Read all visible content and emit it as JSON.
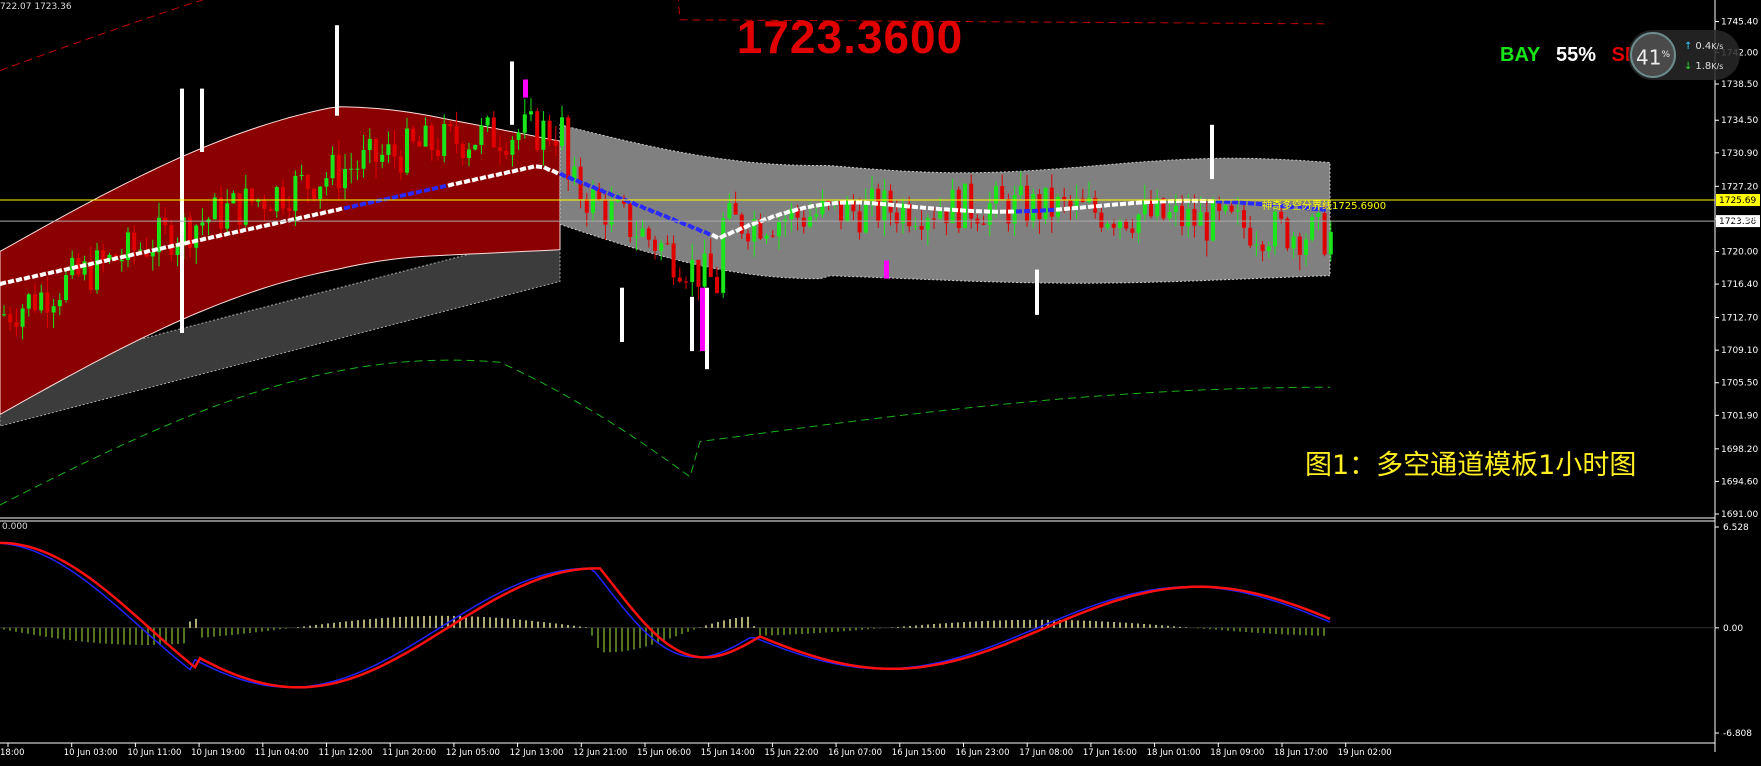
{
  "header": {
    "corner_price": "722.07 1723.36",
    "big_price": "1723.3600"
  },
  "signal": {
    "bay": "BAY",
    "percent": "55%",
    "sell": "SE"
  },
  "widget": {
    "cpu": "41",
    "unit": "%",
    "upload": "0.4",
    "upload_unit": "K/s",
    "download": "1.8",
    "download_unit": "K/s"
  },
  "caption": "图1：多空通道模板1小时图",
  "horizontal_line_label": "神奇多空分界线1725.6900",
  "subwindow_label": "0.000",
  "colors": {
    "bull_candle": "#19e619",
    "bear_candle": "#e00000",
    "upper_channel_fill": "#8b0000",
    "gray_channel_fill": "#808080",
    "dark_channel_fill": "#3c3c3c",
    "outer_top_dashed": "#c00000",
    "outer_bottom_dashed": "#19b019",
    "price_line": "#ffff00",
    "macd_main": "#2222ff",
    "macd_signal": "#ff1010",
    "macd_hist_pos": "#e8e89a",
    "macd_hist_neg": "#6f9a2a"
  },
  "chart_data": [
    {
      "type": "candlestick",
      "title": "",
      "ylim": [
        1691.0,
        1746.9
      ],
      "y_ticks": [
        "1745.40",
        "1742.00",
        "1738.50",
        "1734.50",
        "1730.90",
        "1727.20",
        "1723.60",
        "1720.00",
        "1716.40",
        "1712.70",
        "1709.10",
        "1705.50",
        "1701.90",
        "1698.20",
        "1694.60",
        "1691.00"
      ],
      "price_labels": [
        {
          "text": "1725.69",
          "value": 1725.69,
          "color": "#ffff00"
        },
        {
          "text": "1723.36",
          "value": 1723.36,
          "color": "#ffffff"
        }
      ],
      "x_ticks": [
        "18:00",
        "10 Jun 03:00",
        "10 Jun 11:00",
        "10 Jun 19:00",
        "11 Jun 04:00",
        "11 Jun 12:00",
        "11 Jun 20:00",
        "12 Jun 05:00",
        "12 Jun 13:00",
        "12 Jun 21:00",
        "15 Jun 06:00",
        "15 Jun 14:00",
        "15 Jun 22:00",
        "16 Jun 07:00",
        "16 Jun 15:00",
        "16 Jun 23:00",
        "17 Jun 08:00",
        "17 Jun 16:00",
        "18 Jun 01:00",
        "18 Jun 09:00",
        "18 Jun 17:00",
        "19 Jun 02:00"
      ],
      "trend_line_start": 1716.4,
      "trend_line_end_before_drop": 1729.5,
      "note_segments": {
        "bull_channel": {
          "from": "18:00",
          "to": "12 Jun 21:00"
        },
        "range_channel": {
          "from": "12 Jun 21:00",
          "to": "19 Jun 02:00"
        }
      }
    },
    {
      "type": "macd",
      "title": "",
      "ylim": [
        -6.808,
        6.528
      ],
      "y_ticks": [
        "6.528",
        "0.00",
        "-6.808"
      ]
    }
  ]
}
